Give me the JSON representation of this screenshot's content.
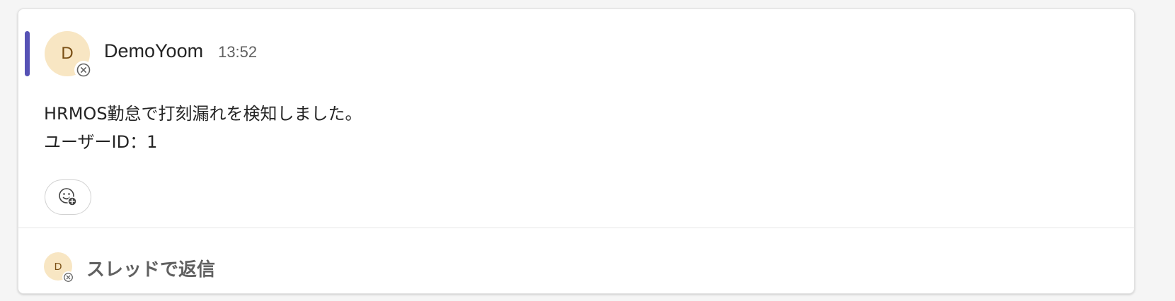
{
  "message": {
    "sender": "DemoYoom",
    "time": "13:52",
    "avatar_initial": "D",
    "lines": [
      "HRMOS勤怠で打刻漏れを検知しました。",
      "ユーザーID：1"
    ]
  },
  "reaction": {
    "icon": "add-reaction-icon"
  },
  "reply": {
    "avatar_initial": "D",
    "label": "スレッドで返信"
  },
  "colors": {
    "accent": "#5652b5",
    "avatar_bg": "#f8e6c3",
    "avatar_text": "#7a4f14"
  }
}
